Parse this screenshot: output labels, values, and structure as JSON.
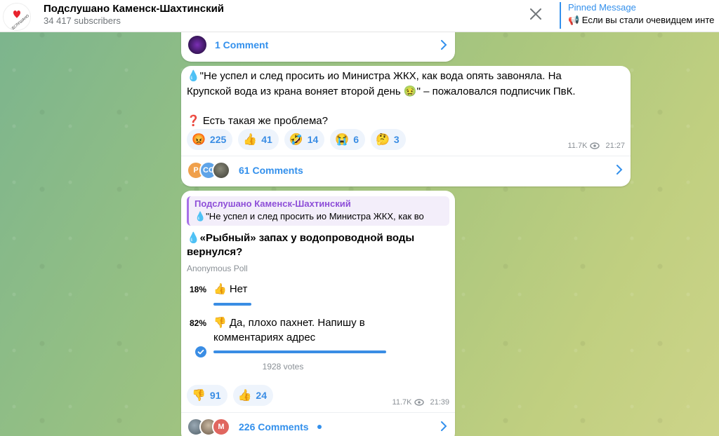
{
  "header": {
    "channel_title": "Подслушано Каменск-Шахтинский",
    "subscribers": "34 417 subscribers",
    "avatar_text": "Подслушано Каменск",
    "pinned_title": "Pinned Message",
    "pinned_text": "📢 Если вы стали очевидцем инте"
  },
  "post1": {
    "comments_label": "1 Comment"
  },
  "post2": {
    "line1": "💧\"Не успел и след просить ио Министра ЖКХ, как вода опять завоняла. На",
    "line2": "Крупской вода из крана воняет второй день 🤢\" – пожаловался подписчик ПвК.",
    "line3": "❓ Есть такая же проблема?",
    "reactions": [
      {
        "emoji": "😡",
        "count": "225"
      },
      {
        "emoji": "👍",
        "count": "41"
      },
      {
        "emoji": "🤣",
        "count": "14"
      },
      {
        "emoji": "😭",
        "count": "6"
      },
      {
        "emoji": "🤔",
        "count": "3"
      }
    ],
    "views": "11.7K",
    "time": "21:27",
    "avatars": [
      "P",
      "CC",
      ""
    ],
    "comments_label": "61 Comments"
  },
  "post3": {
    "fwd_name": "Подслушано Каменск-Шахтинский",
    "fwd_text": "💧\"Не успел и след просить ио Министра ЖКХ, как во",
    "question_line1": "💧«Рыбный» запах у водопроводной воды",
    "question_line2": "вернулся?",
    "poll_type": "Anonymous Poll",
    "options": [
      {
        "pct": "18%",
        "line1": "👍 Нет",
        "line2": "",
        "share": 0.18
      },
      {
        "pct": "82%",
        "line1": "👎 Да, плохо пахнет. Напишу в",
        "line2": "комментариях адрес",
        "share": 0.82
      }
    ],
    "votes": "1928 votes",
    "reactions": [
      {
        "emoji": "👎",
        "count": "91"
      },
      {
        "emoji": "👍",
        "count": "24"
      }
    ],
    "views": "11.7K",
    "time": "21:39",
    "avatars": [
      "",
      "",
      "M"
    ],
    "comments_label": "226 Comments"
  },
  "colors": {
    "accent": "#3390ec",
    "forward": "#8e4fd8"
  }
}
